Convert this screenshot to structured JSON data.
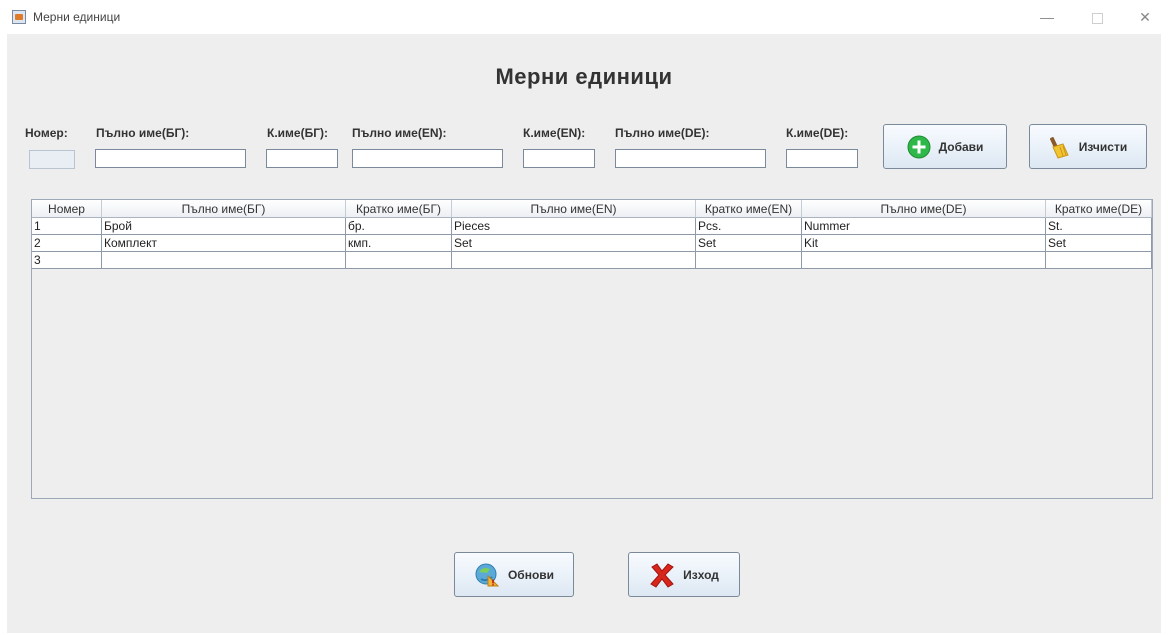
{
  "window": {
    "title": "Мерни единици",
    "minimize_glyph": "—",
    "close_glyph": "✕"
  },
  "heading": "Мерни единици",
  "form": {
    "nomer_label": "Номер:",
    "full_bg_label": "Пълно име(БГ):",
    "short_bg_label": "К.име(БГ):",
    "full_en_label": "Пълно име(EN):",
    "short_en_label": "К.име(EN):",
    "full_de_label": "Пълно име(DE):",
    "short_de_label": "К.име(DE):",
    "values": {
      "nomer": "",
      "full_bg": "",
      "short_bg": "",
      "full_en": "",
      "short_en": "",
      "full_de": "",
      "short_de": ""
    }
  },
  "buttons": {
    "add": "Добави",
    "clear": "Изчисти",
    "refresh": "Обнови",
    "exit": "Изход"
  },
  "table": {
    "columns": [
      "Номер",
      "Пълно име(БГ)",
      "Кратко име(БГ)",
      "Пълно име(EN)",
      "Кратко име(EN)",
      "Пълно име(DE)",
      "Кратко име(DE)"
    ],
    "rows": [
      [
        "1",
        "Брой",
        "бр.",
        "Pieces",
        "Pcs.",
        "Nummer",
        "St."
      ],
      [
        "2",
        "Комплект",
        "кмп.",
        "Set",
        "Set",
        "Kit",
        "Set"
      ],
      [
        "3",
        "",
        "",
        "",
        "",
        "",
        ""
      ]
    ]
  },
  "icons": {
    "add": "plus-circle-icon",
    "clear": "broom-icon",
    "refresh": "refresh-icon",
    "exit": "red-x-icon"
  },
  "colors": {
    "add_icon": "#2fb84a",
    "exit_icon": "#d9261c",
    "panel_bg": "#eeeeee"
  }
}
